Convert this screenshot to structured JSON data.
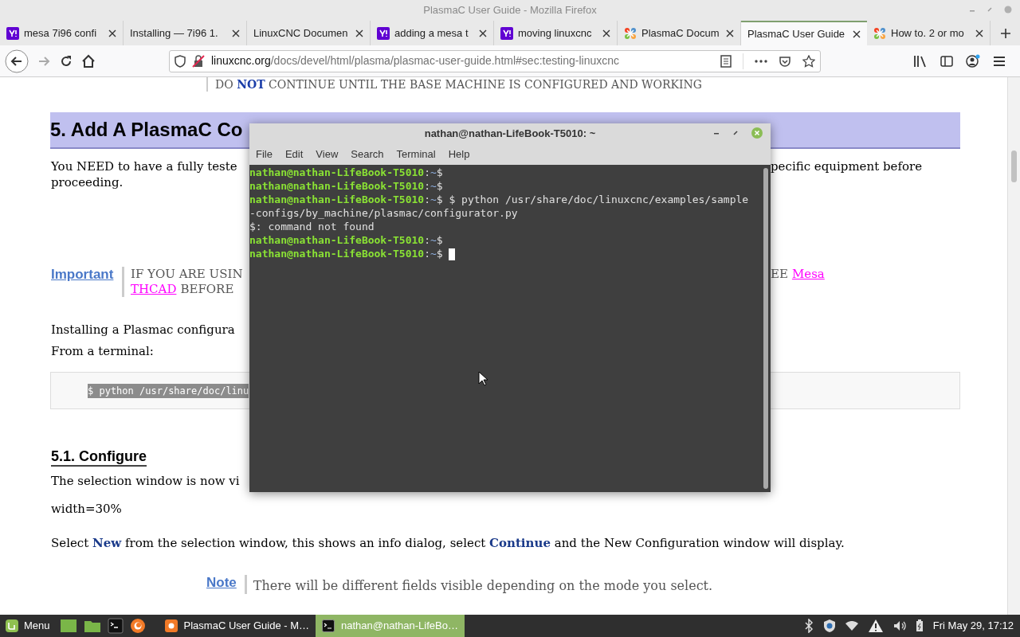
{
  "window": {
    "title": "PlasmaC User Guide - Mozilla Firefox"
  },
  "tabs": [
    {
      "label": "mesa 7i96 confi",
      "kind": "square",
      "selected": false
    },
    {
      "label": "Installing — 7i96 1.",
      "kind": "plain",
      "selected": false
    },
    {
      "label": "LinuxCNC Documen",
      "kind": "plain",
      "selected": false
    },
    {
      "label": "adding a mesa t",
      "kind": "square",
      "selected": false
    },
    {
      "label": "moving linuxcnc",
      "kind": "square",
      "selected": false
    },
    {
      "label": "PlasmaC Docum",
      "kind": "pinwheel",
      "selected": false
    },
    {
      "label": "PlasmaC User Guide",
      "kind": "plain",
      "selected": true
    },
    {
      "label": "How to. 2 or mo",
      "kind": "pinwheel",
      "selected": false
    }
  ],
  "url": {
    "domain": "linuxcnc.org",
    "path": "/docs/devel/html/plasma/plasmac-user-guide.html#sec:testing-linuxcnc"
  },
  "page": {
    "top_note": "DO **NOT** CONTINUE UNTIL THE BASE MACHINE IS CONFIGURED AND WORKING",
    "heading": "5. Add A PlasmaC Co",
    "intro_left": "You NEED to have a fully teste",
    "intro_right": "pecific equipment before",
    "intro_line2": "proceeding.",
    "important": {
      "label": "Important",
      "left": "IF YOU ARE USIN",
      "right": "EE",
      "link": "Mesa",
      "line2_link": "THCAD",
      "line2_text": "BEFORE"
    },
    "install_text": "Installing a Plasmac configura",
    "terminal_text": "From a terminal:",
    "code": "$ python /usr/share/doc/linu",
    "subheading": "5.1. Configure",
    "selection_text": "The selection window is now vi",
    "width_text": "width=30%",
    "select_text": "Select **New** from the selection window, this shows an info dialog, select **Continue** and the New Configuration window will display.",
    "note": {
      "label": "Note",
      "text": "There will be different fields visible depending on the mode you select."
    }
  },
  "terminal": {
    "title": "nathan@nathan-LifeBook-T5010: ~",
    "menu": [
      "File",
      "Edit",
      "View",
      "Search",
      "Terminal",
      "Help"
    ],
    "lines": [
      {
        "kind": "prompt",
        "user": "nathan@nathan-LifeBook-T5010",
        "separator": ":",
        "path": "~",
        "symbol": "$",
        "cursor": false
      },
      {
        "kind": "prompt",
        "user": "nathan@nathan-LifeBook-T5010",
        "separator": ":",
        "path": "~",
        "symbol": "$",
        "cursor": false
      },
      {
        "kind": "prompt",
        "user": "nathan@nathan-LifeBook-T5010",
        "separator": ":",
        "path": "~",
        "symbol": "$",
        "command": " $ python /usr/share/doc/linuxcnc/examples/sample-configs/by_machine/plasmac/configurator.py",
        "cursor": false
      },
      {
        "kind": "output",
        "text": "$: command not found"
      },
      {
        "kind": "prompt",
        "user": "nathan@nathan-LifeBook-T5010",
        "separator": ":",
        "path": "~",
        "symbol": "$",
        "cursor": false
      },
      {
        "kind": "prompt",
        "user": "nathan@nathan-LifeBook-T5010",
        "separator": ":",
        "path": "~",
        "symbol": "$",
        "cursor": true
      }
    ]
  },
  "taskbar": {
    "menu_label": "Menu",
    "windows": [
      {
        "label": "PlasmaC User Guide - M…",
        "kind": "browser",
        "selected": false
      },
      {
        "label": "nathan@nathan-LifeBo…",
        "kind": "terminal",
        "selected": true
      }
    ],
    "clock": "Fri May 29, 17:12"
  }
}
